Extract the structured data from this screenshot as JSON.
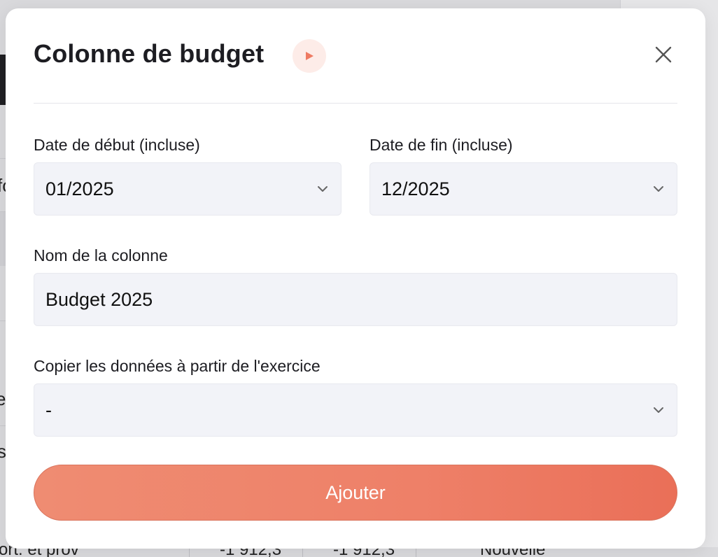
{
  "background": {
    "fragments": [
      "fo",
      "e",
      "s"
    ],
    "bottom_row": [
      "ort. et prov",
      "-1 912,3",
      "-1 912,3",
      "Nouvelle"
    ]
  },
  "modal": {
    "title": "Colonne de budget",
    "play_icon": "play-icon",
    "close_icon": "close-icon",
    "start_date": {
      "label": "Date de début (incluse)",
      "value": "01/2025"
    },
    "end_date": {
      "label": "Date de fin (incluse)",
      "value": "12/2025"
    },
    "column_name": {
      "label": "Nom de la colonne",
      "value": "Budget 2025"
    },
    "copy_from": {
      "label": "Copier les données à partir de l'exercice",
      "value": "-"
    },
    "submit_label": "Ajouter"
  },
  "colors": {
    "accent": "#ee8068",
    "accent_light": "#fdece8",
    "field_bg": "#f2f3f8",
    "title": "#1d1d22"
  }
}
